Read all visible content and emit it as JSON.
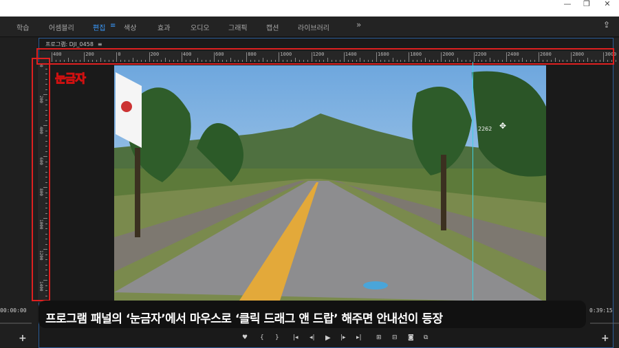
{
  "window_controls": [
    "—",
    "❐",
    "✕"
  ],
  "workspaces": [
    {
      "label": "학습",
      "active": false
    },
    {
      "label": "어셈블리",
      "active": false
    },
    {
      "label": "편집",
      "active": true
    },
    {
      "label": "색상",
      "active": false
    },
    {
      "label": "효과",
      "active": false
    },
    {
      "label": "오디오",
      "active": false
    },
    {
      "label": "그래픽",
      "active": false
    },
    {
      "label": "캡션",
      "active": false
    },
    {
      "label": "라이브러리",
      "active": false
    }
  ],
  "workspace_menu_glyph": "≡",
  "overflow_glyph": "»",
  "export_glyph": "⇪",
  "program_panel": {
    "title": "프로그램: DJI_0458",
    "menu_glyph": "≡"
  },
  "ruler": {
    "labels": [
      "400",
      "200",
      "0",
      "200",
      "400",
      "600",
      "800",
      "1000",
      "1200",
      "1400",
      "1600",
      "1800",
      "2000",
      "2200",
      "2400",
      "2600",
      "2800",
      "3000"
    ],
    "vertical_labels": [
      "0",
      "200",
      "400",
      "600",
      "800",
      "1000",
      "1200",
      "1400"
    ]
  },
  "guide": {
    "value": "2262"
  },
  "callout": {
    "text": "눈금자"
  },
  "caption": {
    "text": "프로그램 패널의 ‘눈금자’에서 마우스로 ‘클릭 드래그 앤 드랍’ 해주면 안내선이 등장"
  },
  "timecode": {
    "left": "00:00:00",
    "right": "0:39:15"
  },
  "controls": {
    "marker": "♥",
    "mark_in": "{",
    "mark_out": "}",
    "go_to_in": "|◂",
    "step_back": "◂|",
    "play": "▶",
    "step_forward": "|▸",
    "go_to_out": "▸|",
    "insert": "⊞",
    "overwrite": "⊟",
    "export_frame": "◙",
    "compare": "⧉",
    "add": "+"
  },
  "colors": {
    "accent": "#3a9bff",
    "highlight": "#e02020",
    "guide": "#3fd1e0"
  }
}
